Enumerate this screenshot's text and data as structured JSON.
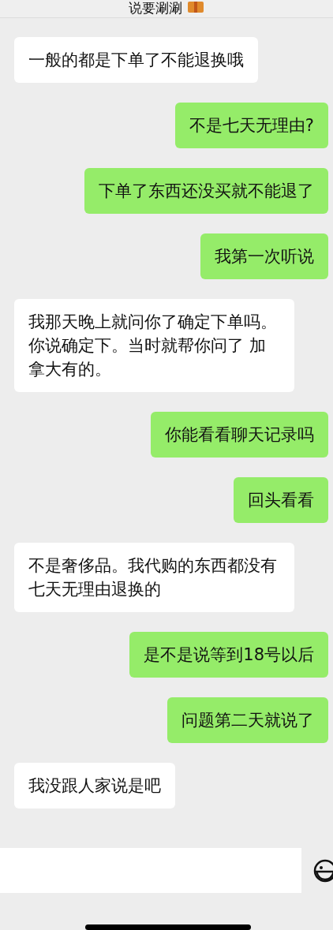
{
  "header": {
    "title": "说要涮涮"
  },
  "messages": [
    {
      "kind": "received",
      "text": "一般的都是下单了不能退换哦"
    },
    {
      "kind": "sent",
      "text": "不是七天无理由?"
    },
    {
      "kind": "sent",
      "text": "下单了东西还没买就不能退了"
    },
    {
      "kind": "sent",
      "text": "我第一次听说"
    },
    {
      "kind": "received",
      "text": "我那天晚上就问你了确定下单吗。你说确定下。当时就帮你问了 加拿大有的。"
    },
    {
      "kind": "sent",
      "text": "你能看看聊天记录吗"
    },
    {
      "kind": "sent",
      "text": "回头看看"
    },
    {
      "kind": "received",
      "text": "不是奢侈品。我代购的东西都没有七天无理由退换的"
    },
    {
      "kind": "sent",
      "text": "是不是说等到18号以后"
    },
    {
      "kind": "sent",
      "text": "问题第二天就说了"
    },
    {
      "kind": "received",
      "text": "我没跟人家说是吧"
    }
  ]
}
